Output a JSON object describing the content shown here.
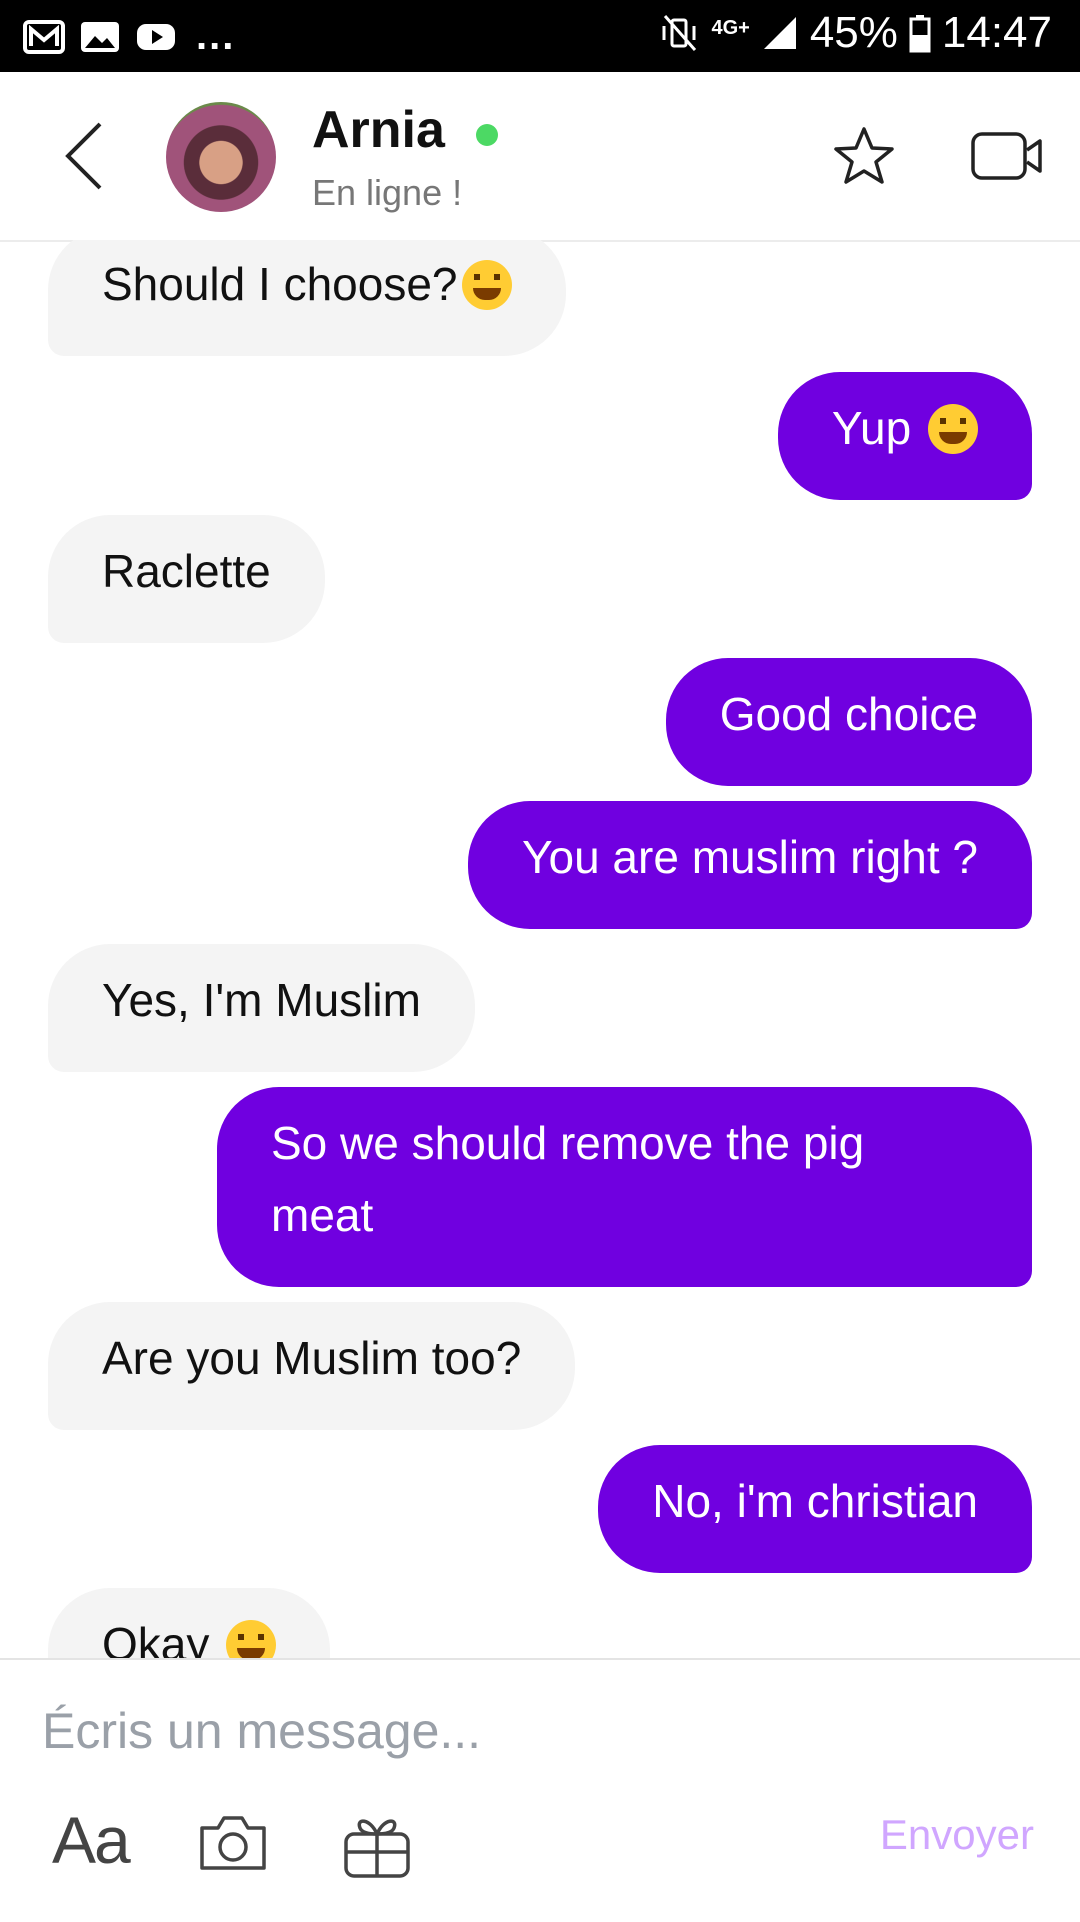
{
  "status_bar": {
    "left_icons": [
      "gmail-icon",
      "gallery-icon",
      "youtube-icon"
    ],
    "overflow": "...",
    "network": "4G+",
    "battery": "45%",
    "time": "14:47"
  },
  "header": {
    "name": "Arnia",
    "status": "En ligne !",
    "online_color": "#4cd964"
  },
  "messages": [
    {
      "side": "in",
      "text": "Should I choose?",
      "emoji": true
    },
    {
      "side": "out",
      "text": "Yup ",
      "emoji": true
    },
    {
      "side": "in",
      "text": "Raclette",
      "emoji": false
    },
    {
      "side": "out",
      "text": "Good choice",
      "emoji": false
    },
    {
      "side": "out",
      "text": "You are muslim right ?",
      "emoji": false
    },
    {
      "side": "in",
      "text": "Yes, I'm Muslim",
      "emoji": false
    },
    {
      "side": "out",
      "text": "So we should remove the pig meat",
      "emoji": false
    },
    {
      "side": "in",
      "text": "Are you Muslim too?",
      "emoji": false
    },
    {
      "side": "out",
      "text": "No, i'm christian",
      "emoji": false
    },
    {
      "side": "in",
      "text": "Okay ",
      "emoji": true
    }
  ],
  "composer": {
    "placeholder": "Écris un message...",
    "text_tool": "Aa",
    "send_label": "Envoyer"
  },
  "colors": {
    "outgoing_bubble": "#7000e0",
    "incoming_bubble": "#f4f4f4",
    "send_label": "#d0a6ff"
  }
}
